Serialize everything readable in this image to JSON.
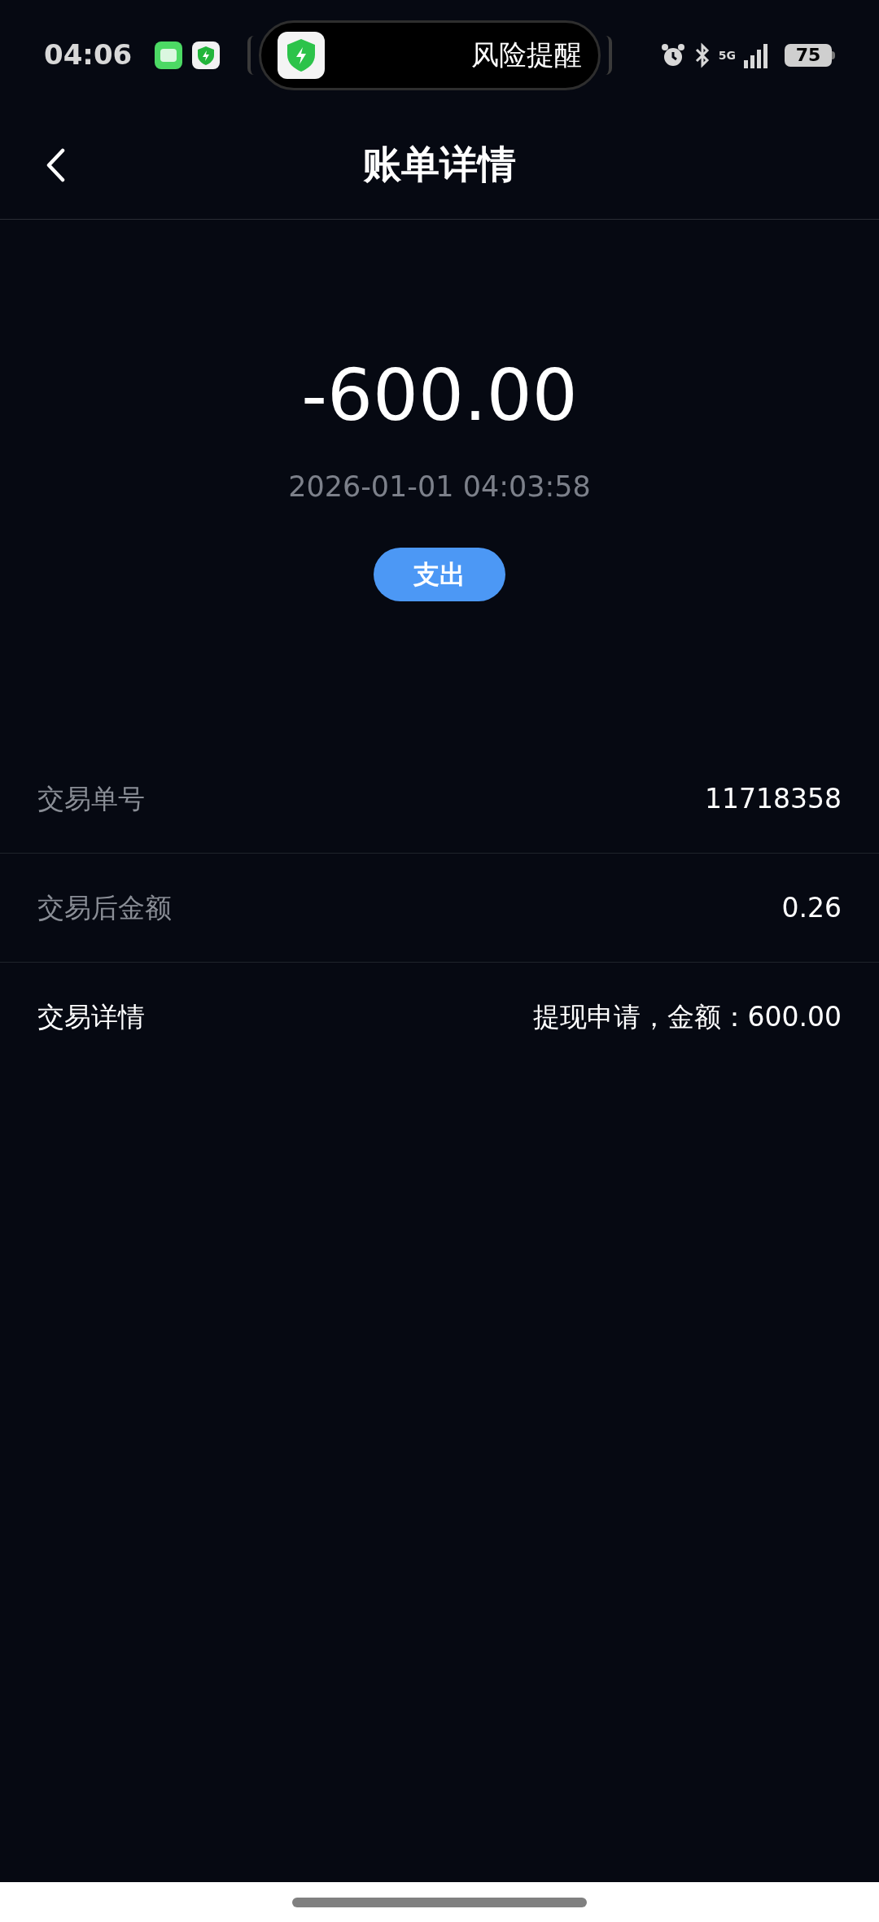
{
  "status_bar": {
    "time": "04:06",
    "island_text": "风险提醒",
    "battery": "75",
    "network": "5G"
  },
  "header": {
    "title": "账单详情"
  },
  "summary": {
    "amount": "-600.00",
    "datetime": "2026-01-01 04:03:58",
    "type_badge": "支出"
  },
  "details": [
    {
      "label": "交易单号",
      "value": "11718358",
      "emphasis": false
    },
    {
      "label": "交易后金额",
      "value": "0.26",
      "emphasis": false
    },
    {
      "label": "交易详情",
      "value": "提现申请，金额：600.00",
      "emphasis": true
    }
  ]
}
